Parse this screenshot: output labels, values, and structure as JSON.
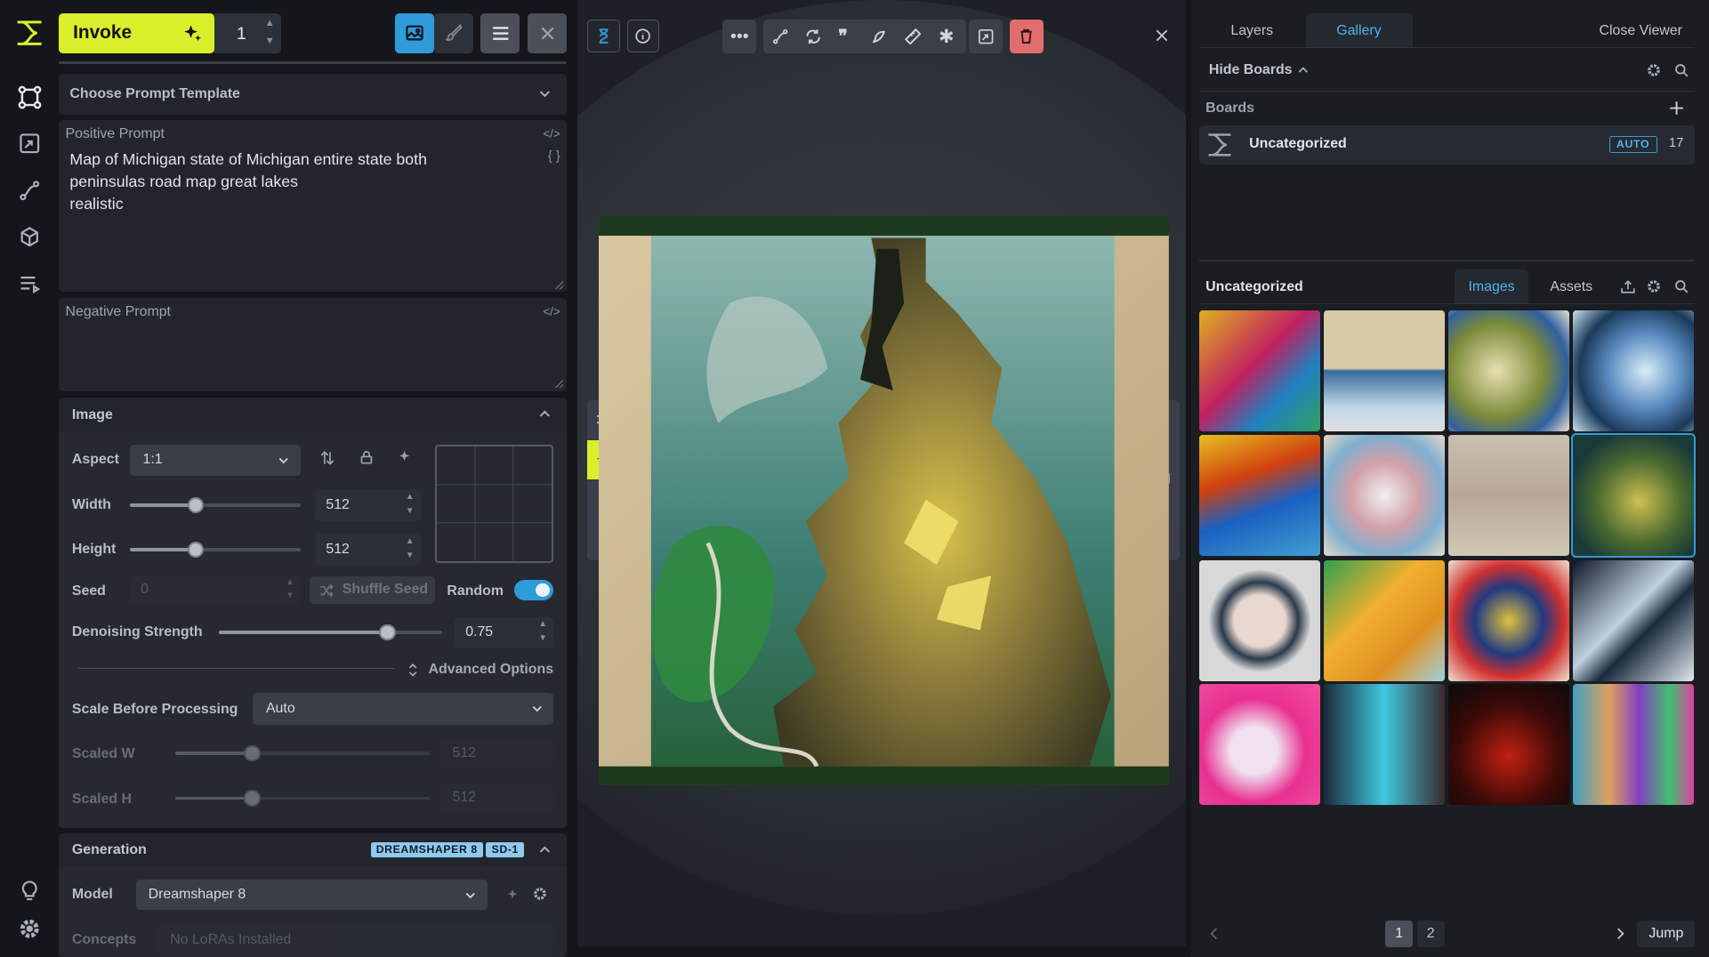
{
  "app": {
    "invoke_label": "Invoke",
    "iterations": "1"
  },
  "prompt_template": {
    "label": "Choose Prompt Template"
  },
  "positive_prompt": {
    "label": "Positive Prompt",
    "value": "Map of Michigan state of Michigan entire state both peninsulas road map great lakes\nrealistic"
  },
  "negative_prompt": {
    "label": "Negative Prompt",
    "value": ""
  },
  "image_section": {
    "title": "Image",
    "aspect_label": "Aspect",
    "aspect_value": "1:1",
    "width_label": "Width",
    "width_value": "512",
    "width_slider": 0.38,
    "height_label": "Height",
    "height_value": "512",
    "height_slider": 0.38,
    "seed_label": "Seed",
    "seed_value": "0",
    "shuffle_label": "Shuffle Seed",
    "random_label": "Random",
    "random_on": true,
    "denoise_label": "Denoising Strength",
    "denoise_value": "0.75",
    "denoise_slider": 0.75,
    "advanced_label": "Advanced Options",
    "scale_label": "Scale Before Processing",
    "scale_value": "Auto",
    "scaled_w_label": "Scaled W",
    "scaled_w_value": "512",
    "scaled_h_label": "Scaled H",
    "scaled_h_value": "512",
    "scaled_slider": 0.3
  },
  "generation": {
    "title": "Generation",
    "badge_model": "DREAMSHAPER 8",
    "badge_base": "SD-1",
    "model_label": "Model",
    "model_value": "Dreamshaper 8",
    "concepts_label": "Concepts",
    "concepts_placeholder": "No LoRAs Installed"
  },
  "right_panel": {
    "tab_layers": "Layers",
    "tab_gallery": "Gallery",
    "close_viewer": "Close Viewer",
    "hide_boards": "Hide Boards",
    "boards_label": "Boards",
    "board_name": "Uncategorized",
    "board_auto": "AUTO",
    "board_count": "17",
    "gallery_title": "Uncategorized",
    "tab_images": "Images",
    "tab_assets": "Assets",
    "pages": [
      "1",
      "2"
    ],
    "jump_label": "Jump"
  },
  "colors": {
    "accent": "#dbee2a",
    "blue": "#2f9bd9",
    "delete": "#e26d6d"
  }
}
